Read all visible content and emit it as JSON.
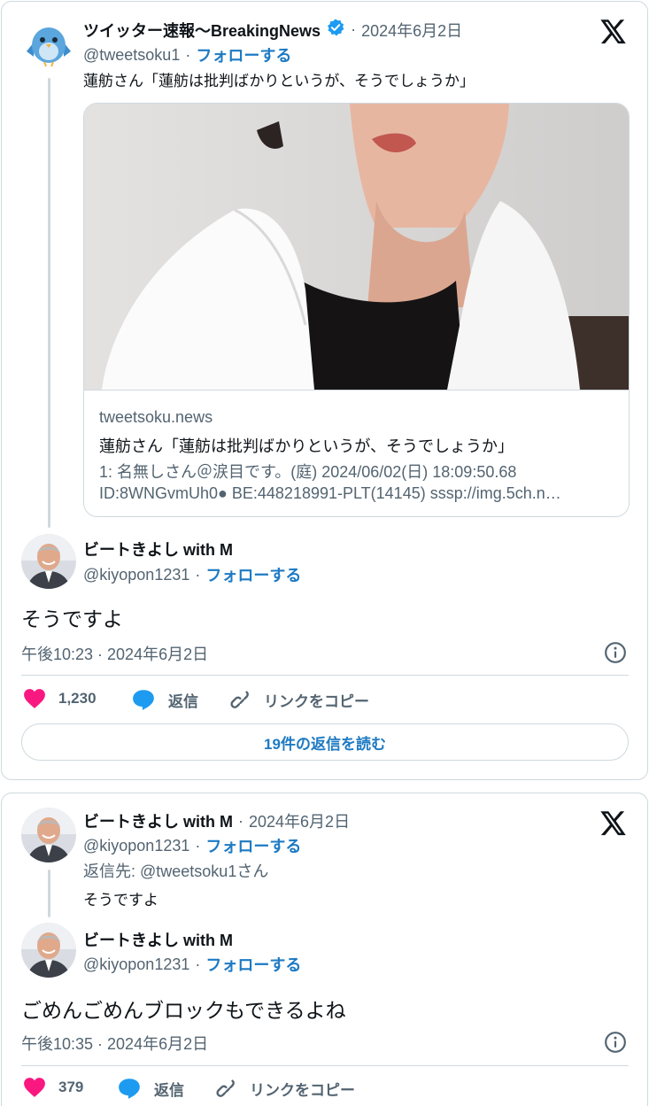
{
  "tweet1": {
    "author": {
      "name": "ツイッター速報〜BreakingNews",
      "handle": "@tweetsoku1",
      "follow_label": "フォローする",
      "date": "2024年6月2日",
      "separator": "·"
    },
    "text": "蓮舫さん「蓮舫は批判ばかりというが、そうでしょうか」",
    "link_card": {
      "domain": "tweetsoku.news",
      "title": "蓮舫さん「蓮舫は批判ばかりというが、そうでしょうか」",
      "desc_line1": "1: 名無しさん＠涙目です。(庭) 2024/06/02(日) 18:09:50.68",
      "desc_line2": "ID:8WNGvmUh0● BE:448218991-PLT(14145) sssp://img.5ch.n…"
    }
  },
  "reply1": {
    "author": {
      "name": "ビートきよし with M",
      "handle": "@kiyopon1231",
      "follow_label": "フォローする",
      "separator": "·"
    },
    "text": "そうですよ",
    "timestamp": "午後10:23 · 2024年6月2日",
    "actions": {
      "like_count": "1,230",
      "reply_label": "返信",
      "copy_label": "リンクをコピー"
    },
    "read_replies_label": "19件の返信を読む"
  },
  "tweet2": {
    "author": {
      "name": "ビートきよし with M",
      "handle": "@kiyopon1231",
      "follow_label": "フォローする",
      "date": "2024年6月2日",
      "separator": "·"
    },
    "reply_to": "返信先: @tweetsoku1さん",
    "text": "そうですよ"
  },
  "reply2": {
    "author": {
      "name": "ビートきよし with M",
      "handle": "@kiyopon1231",
      "follow_label": "フォローする",
      "separator": "·"
    },
    "text": "ごめんごめんブロックもできるよね",
    "timestamp": "午後10:35 · 2024年6月2日",
    "actions": {
      "like_count": "379",
      "reply_label": "返信",
      "copy_label": "リンクをコピー"
    }
  },
  "colors": {
    "accent": "#1d7ac3",
    "verified": "#1d9bf0",
    "like": "#f91880",
    "muted": "#536471",
    "border": "#cfd9de"
  }
}
